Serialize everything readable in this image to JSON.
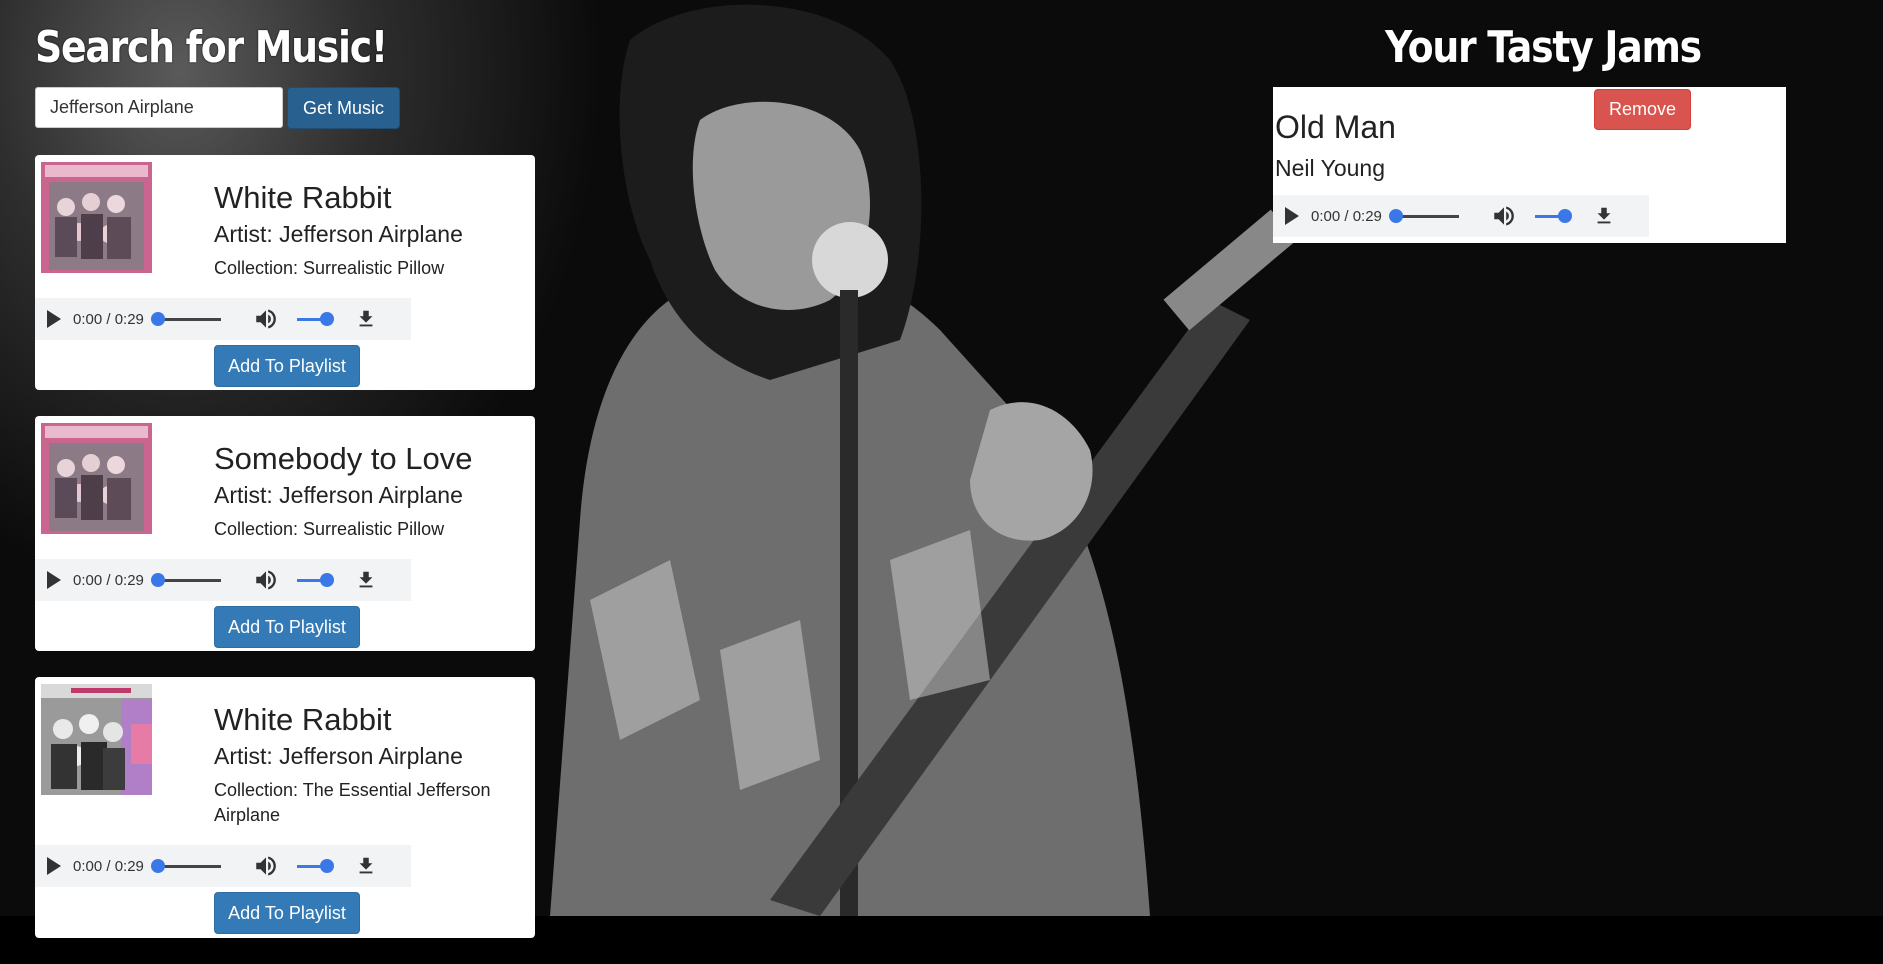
{
  "search": {
    "heading": "Search for Music!",
    "query": "Jefferson Airplane",
    "button_label": "Get Music"
  },
  "results": [
    {
      "track": "White Rabbit",
      "artist": "Artist: Jefferson Airplane",
      "collection": "Collection: Surrealistic Pillow",
      "time": "0:00 / 0:29",
      "add_label": "Add To Playlist",
      "cover": "surrealistic-pillow-cover"
    },
    {
      "track": "Somebody to Love",
      "artist": "Artist: Jefferson Airplane",
      "collection": "Collection: Surrealistic Pillow",
      "time": "0:00 / 0:29",
      "add_label": "Add To Playlist",
      "cover": "surrealistic-pillow-cover"
    },
    {
      "track": "White Rabbit",
      "artist": "Artist: Jefferson Airplane",
      "collection": "Collection: The Essential Jefferson Airplane",
      "time": "0:00 / 0:29",
      "add_label": "Add To Playlist",
      "cover": "essential-jefferson-airplane-cover"
    }
  ],
  "playlist": {
    "heading": "Your Tasty Jams",
    "items": [
      {
        "track": "Old Man",
        "artist": "Neil Young",
        "time": "0:00 / 0:29",
        "remove_label": "Remove"
      }
    ]
  },
  "colors": {
    "primary": "#337ab7",
    "danger": "#d9534f",
    "audio_accent": "#3b78e7"
  },
  "icons": {
    "play": "play-icon",
    "volume": "volume-icon",
    "download": "download-icon"
  }
}
